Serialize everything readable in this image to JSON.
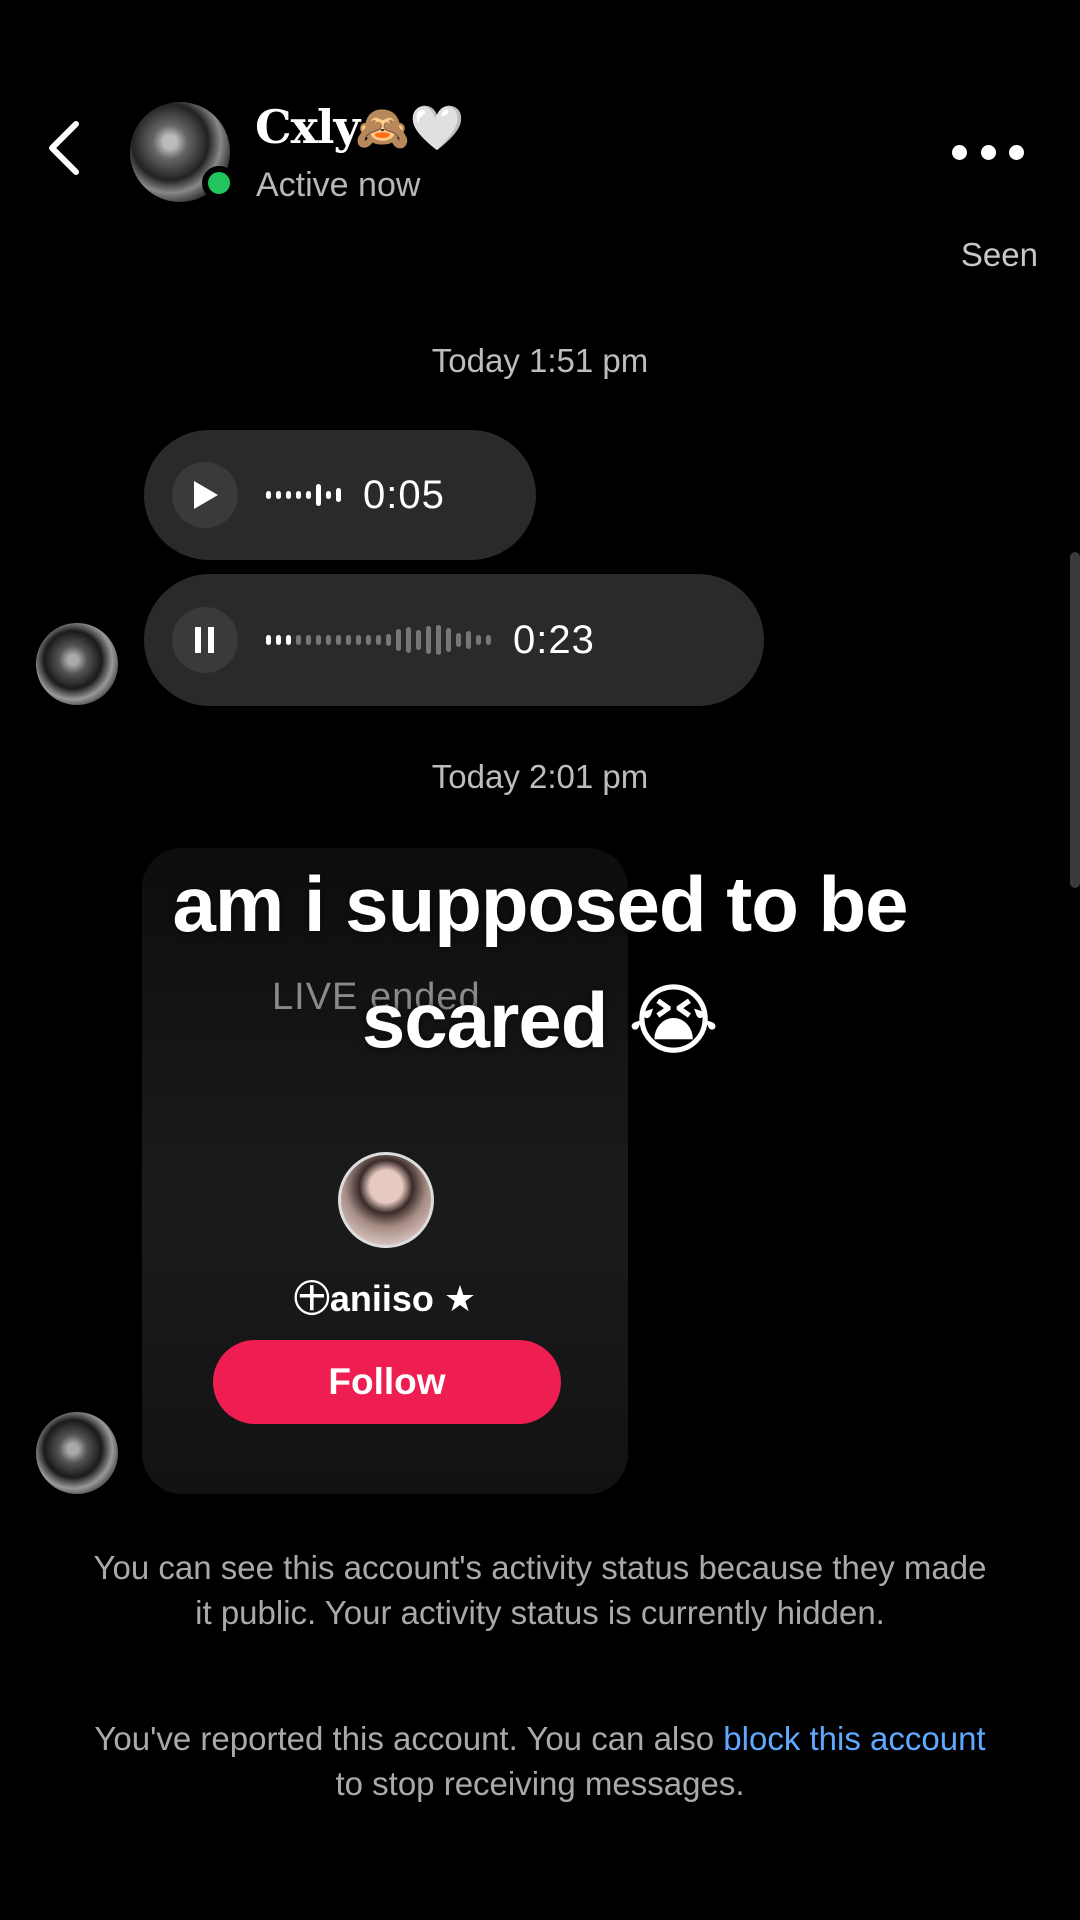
{
  "header": {
    "contact_name": "Cxly",
    "contact_emoji": "🙈🤍",
    "status": "Active now"
  },
  "seen_label": "Seen",
  "timestamps": [
    "Today 1:51 pm",
    "Today 2:01 pm"
  ],
  "voice_messages": [
    {
      "duration": "0:05",
      "state": "paused"
    },
    {
      "duration": "0:23",
      "state": "playing"
    }
  ],
  "live_card": {
    "label": "LIVE ended",
    "username": "㊉aniiso ★",
    "follow_label": "Follow"
  },
  "caption": {
    "line1": "am i supposed to be",
    "line2": "scared 😭"
  },
  "info": {
    "activity_notice": "You can see this account's activity status because they made it public. Your activity status is currently hidden.",
    "report_prefix": "You've reported this account. You can also ",
    "report_link": "block this account",
    "report_suffix": " to stop receiving messages."
  },
  "colors": {
    "accent_follow": "#ee1d52",
    "online": "#22c55e",
    "link": "#5ea9ff"
  }
}
